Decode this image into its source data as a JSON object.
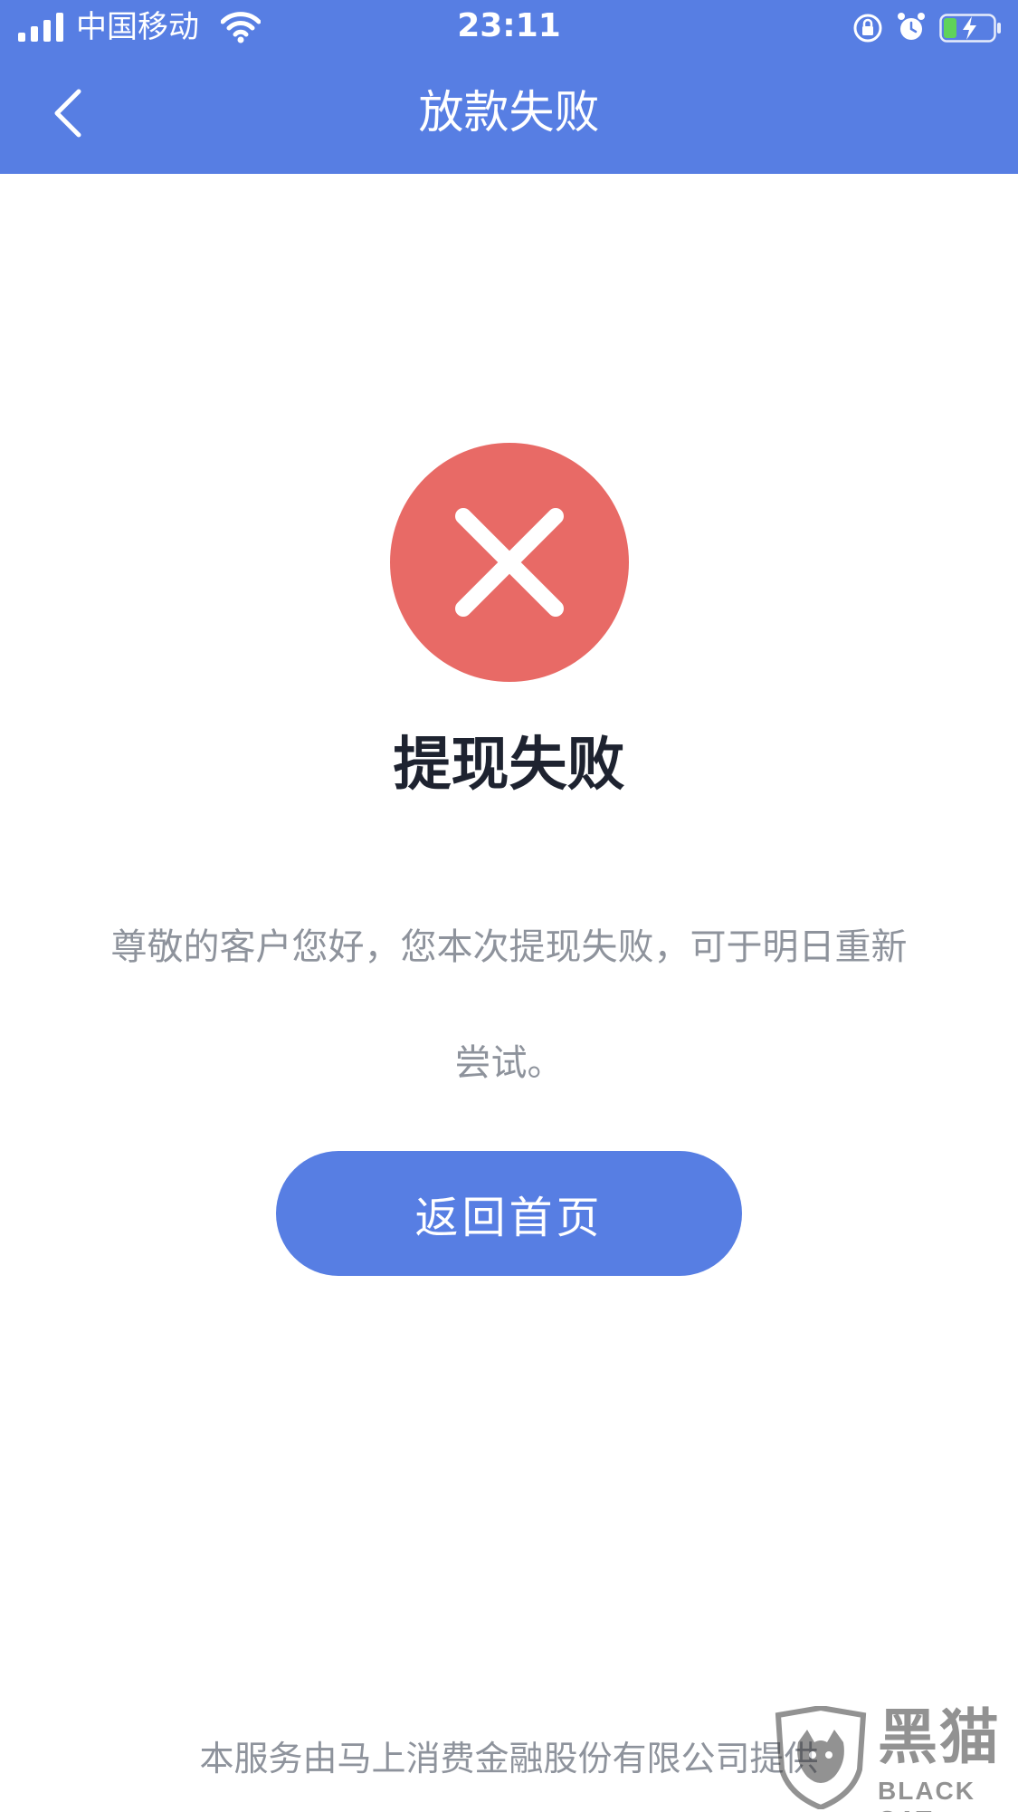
{
  "status_bar": {
    "carrier": "中国移动",
    "time": "23:11",
    "icons": [
      "signal-icon",
      "wifi-icon",
      "rotation-lock-icon",
      "alarm-icon",
      "battery-charging-icon"
    ]
  },
  "nav": {
    "title": "放款失败",
    "back_icon": "chevron-left-icon"
  },
  "result": {
    "icon": "error-x-icon",
    "title": "提现失败",
    "message": "尊敬的客户您好，您本次提现失败，可于明日重新尝试。"
  },
  "actions": {
    "home_button": "返回首页"
  },
  "footer": {
    "provider_text": "本服务由马上消费金融股份有限公司提供"
  },
  "watermark": {
    "name": "黑猫",
    "sub": "BLACK CAT"
  },
  "colors": {
    "primary": "#577ee3",
    "error": "#e86a66",
    "title": "#1e2330",
    "muted": "#8e939c"
  }
}
